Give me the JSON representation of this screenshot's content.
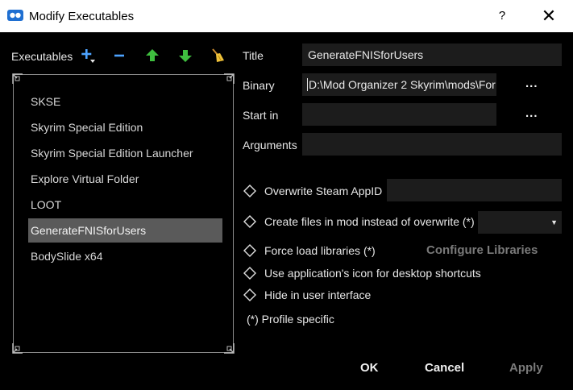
{
  "window": {
    "title": "Modify Executables",
    "help_label": "?",
    "close_label": "✕"
  },
  "executables": {
    "label": "Executables",
    "items": [
      "SKSE",
      "Skyrim Special Edition",
      "Skyrim Special Edition Launcher",
      "Explore Virtual Folder",
      "LOOT",
      "GenerateFNISforUsers",
      "BodySlide x64"
    ],
    "selected": "GenerateFNISforUsers"
  },
  "form": {
    "title_label": "Title",
    "title_value": "GenerateFNISforUsers",
    "binary_label": "Binary",
    "binary_value": "D:\\Mod Organizer 2 Skyrim\\mods\\For",
    "browse_label": "...",
    "start_in_label": "Start in",
    "start_in_value": "",
    "arguments_label": "Arguments",
    "arguments_value": ""
  },
  "options": {
    "overwrite_steam_appid": "Overwrite Steam AppID",
    "create_files_in_mod": "Create files in mod instead of overwrite (*)",
    "force_load_libraries": "Force load libraries (*)",
    "configure_libraries": "Configure Libraries",
    "use_app_icon": "Use application's icon for desktop shortcuts",
    "hide_in_ui": "Hide in user interface",
    "profile_specific": "(*) Profile specific"
  },
  "buttons": {
    "ok": "OK",
    "cancel": "Cancel",
    "apply": "Apply"
  },
  "colors": {
    "background": "#000000",
    "titlebar": "#ffffff",
    "selected_row": "#5a5a5a",
    "field_bg": "#1c1c1c",
    "add_icon": "#4da3ff",
    "arrow_icon": "#3fbf3f",
    "disabled_text": "#7a7a7a"
  }
}
